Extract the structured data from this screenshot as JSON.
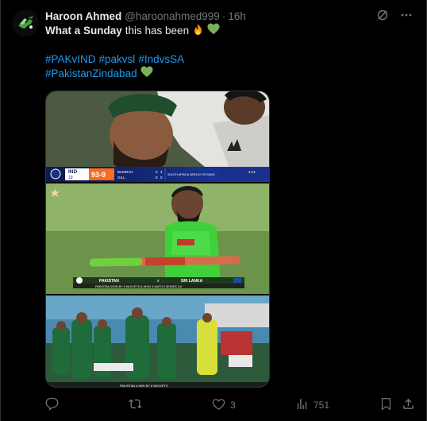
{
  "post": {
    "author_name": "Haroon Ahmed",
    "author_handle": "@haroonahmed999",
    "separator": "·",
    "time": "16h",
    "text_bold": "What a Sunday",
    "text_rest": "this has been",
    "text_emojis": [
      "fire-emoji",
      "green-heart-emoji"
    ],
    "hashtags_line1": [
      "#PAKvIND",
      "#pakvsl",
      "#IndvsSA"
    ],
    "hashtags_line2": [
      "#PakistanZindabad"
    ]
  },
  "media": {
    "images": [
      {
        "description_icon": "photo",
        "scorebar": {
          "team": "IND",
          "score": "93-9",
          "overs": "19",
          "batter1": "BUMRAH",
          "batter1_runs": "0",
          "batter1_balls": "4",
          "batter2": "GILL",
          "batter2_runs": "0",
          "batter2_balls": "0",
          "result": "SOUTH AFRICA WON BY 20 RUNS",
          "extra": "4-21"
        }
      },
      {
        "scorebar": {
          "team1": "PAKISTAN",
          "vs": "v",
          "team2": "SRI LANKA",
          "result": "PAKISTAN WON BY 6 WICKETS & WON 3-MATCH SERIES 3-0"
        }
      },
      {
        "caption": "PAKISTAN A WIN BY 8 WICKETS"
      }
    ]
  },
  "actions": {
    "reply_count": "",
    "repost_count": "",
    "like_count": "3",
    "views_count": "751"
  },
  "colors": {
    "background": "#000000",
    "text_primary": "#e7e9ea",
    "text_secondary": "#71767b",
    "link": "#1d9bf0",
    "border": "#2f3336"
  }
}
